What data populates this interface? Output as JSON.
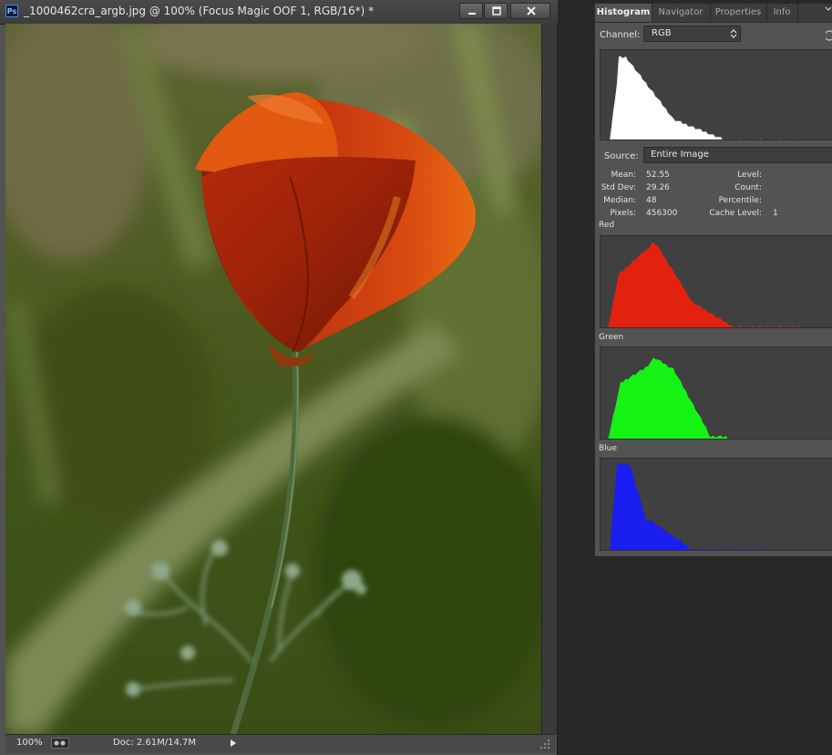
{
  "document": {
    "title": "_1000462cra_argb.jpg @ 100% (Focus Magic OOF 1, RGB/16*) *",
    "app_icon_text": "Ps",
    "zoom": "100%",
    "doc_size": "Doc: 2.61M/14.7M"
  },
  "panel": {
    "tabs": [
      {
        "label": "Histogram",
        "active": true
      },
      {
        "label": "Navigator",
        "active": false
      },
      {
        "label": "Properties",
        "active": false
      },
      {
        "label": "Info",
        "active": false
      }
    ],
    "channel_label": "Channel:",
    "channel_value": "RGB",
    "source_label": "Source:",
    "source_value": "Entire Image",
    "stats_left": [
      {
        "label": "Mean:",
        "value": "52.55"
      },
      {
        "label": "Std Dev:",
        "value": "29.26"
      },
      {
        "label": "Median:",
        "value": "48"
      },
      {
        "label": "Pixels:",
        "value": "456300"
      }
    ],
    "stats_right": [
      {
        "label": "Level:",
        "value": ""
      },
      {
        "label": "Count:",
        "value": ""
      },
      {
        "label": "Percentile:",
        "value": ""
      },
      {
        "label": "Cache Level:",
        "value": "1"
      }
    ],
    "channels": [
      {
        "name": "Red",
        "color": "#e2220f"
      },
      {
        "name": "Green",
        "color": "#15f314"
      },
      {
        "name": "Blue",
        "color": "#1a1ef0"
      }
    ],
    "composite_color": "#ffffff"
  },
  "icons": {
    "minimize": "minimize-icon",
    "maximize": "maximize-icon",
    "close": "close-icon",
    "panel_menu": "panel-menu-icon",
    "refresh": "refresh-icon"
  }
}
